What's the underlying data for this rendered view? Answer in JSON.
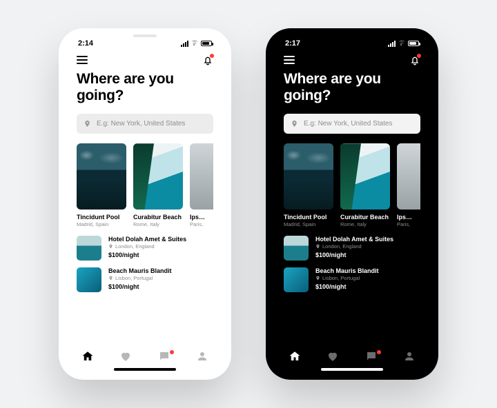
{
  "left": {
    "theme": "light",
    "time": "2:14"
  },
  "right": {
    "theme": "dark",
    "time": "2:17"
  },
  "heading": "Where are you going?",
  "search": {
    "placeholder": "E.g: New York, United States"
  },
  "cards": [
    {
      "title": "Tincidunt Pool",
      "sub": "Madrid, Spain"
    },
    {
      "title": "Curabitur Beach",
      "sub": "Rome, Italy"
    },
    {
      "title": "Ipsum",
      "sub": "Paris,"
    }
  ],
  "list": [
    {
      "name": "Hotel Dolah Amet & Suites",
      "loc": "London, England",
      "price": "$100/night"
    },
    {
      "name": "Beach Mauris Blandit",
      "loc": "Lisbon, Portugal",
      "price": "$100/night"
    }
  ],
  "wifi_glyph": "▲"
}
